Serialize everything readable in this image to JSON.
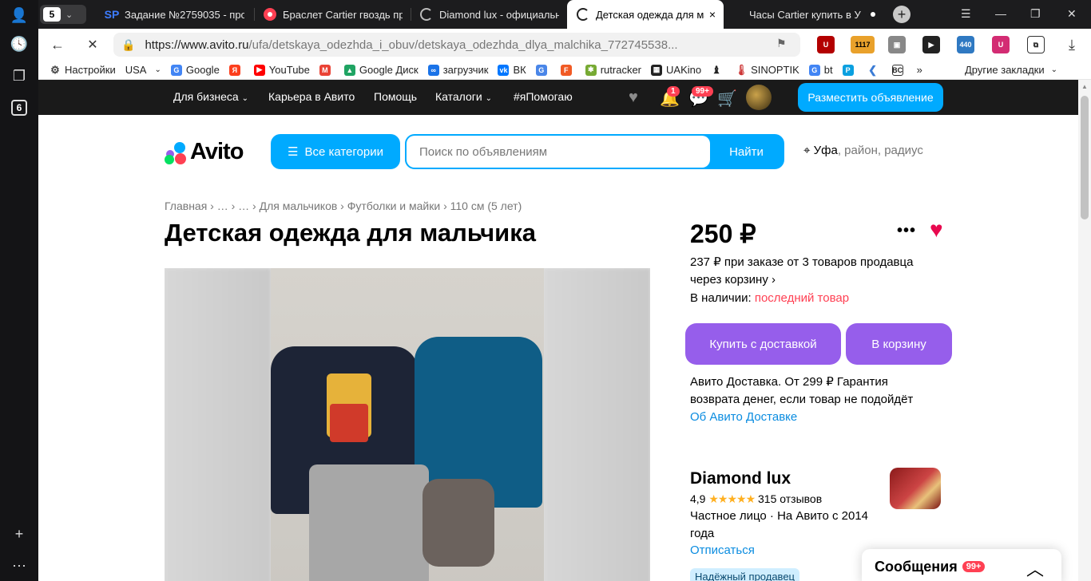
{
  "rail": {
    "badge": "6",
    "add": "+",
    "more": "⋯"
  },
  "tabs": {
    "counter": "5",
    "items": [
      {
        "title": "Задание №2759035 - про",
        "icon": "SP"
      },
      {
        "title": "Браслет Cartier гвоздь пр",
        "icon": ""
      },
      {
        "title": "Diamond lux - официальн",
        "icon": ""
      },
      {
        "title": "Детская одежда для ма",
        "icon": ""
      },
      {
        "title": "Часы Cartier купить в У",
        "icon": ""
      }
    ],
    "close": "×"
  },
  "toolbar": {
    "url_host": "https://www.avito.ru",
    "url_path": "/ufa/detskaya_odezhda_i_obuv/detskaya_odezhda_dlya_malchika_772745538...",
    "ext_counter": "1117",
    "ext_440": "440"
  },
  "bookmarks": [
    {
      "label": "Настройки",
      "color": "#444"
    },
    {
      "label": "USA",
      "color": "#fff"
    },
    {
      "label": "Google",
      "color": "#4285f4"
    },
    {
      "label": "",
      "color": "#fc3f1d"
    },
    {
      "label": "YouTube",
      "color": "#ff0000"
    },
    {
      "label": "",
      "color": "#ea4335"
    },
    {
      "label": "Google Диск",
      "color": "#1fa463"
    },
    {
      "label": "загрузчик",
      "color": "#1a73e8"
    },
    {
      "label": "ВК",
      "color": "#0077ff"
    },
    {
      "label": "",
      "color": "#4a86e8"
    },
    {
      "label": "",
      "color": "#f15a24"
    },
    {
      "label": "rutracker",
      "color": "#7a3"
    },
    {
      "label": "UAKino",
      "color": "#222"
    },
    {
      "label": "",
      "color": "#444"
    },
    {
      "label": "SINOPTIK",
      "color": "#c33"
    },
    {
      "label": "bt",
      "color": "#4285f4"
    },
    {
      "label": "",
      "color": "#0aa0e0"
    },
    {
      "label": "",
      "color": "#3a7bd5"
    },
    {
      "label": "",
      "color": "#333"
    }
  ],
  "bookmarks_other": "Другие закладки",
  "avito": {
    "nav": [
      "Для бизнеса",
      "Карьера в Авито",
      "Помощь",
      "Каталоги",
      "#яПомогаю"
    ],
    "notif_badge": "1",
    "msg_badge": "99+",
    "post_button": "Разместить объявление",
    "logo_text": "Avito",
    "categories_button": "Все категории",
    "search_placeholder": "Поиск по объявлениям",
    "search_button": "Найти",
    "location_city": "Уфа",
    "location_rest": ", район, радиус",
    "breadcrumbs": "Главная  ›  …  ›  …  ›  Для мальчиков  ›  Футболки и майки  ›  110 см (5 лет)",
    "title": "Детская одежда для мальчика",
    "price": "250 ₽",
    "bulk_price": "237 ₽ при заказе от 3 товаров продавца через корзину ›",
    "availability_label": "В наличии:",
    "availability_value": "последний товар",
    "buy_button": "Купить с доставкой",
    "cart_button": "В корзину",
    "delivery_text": "Авито Доставка. От 299 ₽ Гарантия возврата денег, если товар не подойдёт",
    "delivery_link": "Об Авито Доставке",
    "seller_name": "Diamond lux",
    "seller_rating": "4,9",
    "seller_stars": "★★★★★",
    "seller_reviews": "315 отзывов",
    "seller_type": "Частное лицо · На Авито с 2014 года",
    "unsubscribe": "Отписаться",
    "trusted": "Надёжный продавец",
    "messages_label": "Сообщения",
    "messages_badge": "99+"
  },
  "colors": {
    "accent": "#00aaff",
    "purple": "#965eeb",
    "red": "#ff4053",
    "heart": "#e8094f"
  }
}
